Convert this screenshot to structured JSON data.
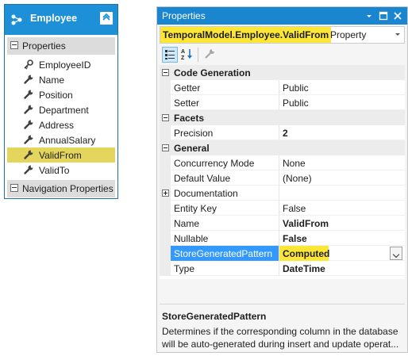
{
  "entity": {
    "title": "Employee",
    "properties_label": "Properties",
    "properties": [
      {
        "label": "EmployeeID",
        "icon": "key-icon",
        "selected": false
      },
      {
        "label": "Name",
        "icon": "wrench-icon",
        "selected": false
      },
      {
        "label": "Position",
        "icon": "wrench-icon",
        "selected": false
      },
      {
        "label": "Department",
        "icon": "wrench-icon",
        "selected": false
      },
      {
        "label": "Address",
        "icon": "wrench-icon",
        "selected": false
      },
      {
        "label": "AnnualSalary",
        "icon": "wrench-icon",
        "selected": false
      },
      {
        "label": "ValidFrom",
        "icon": "wrench-icon",
        "selected": true
      },
      {
        "label": "ValidTo",
        "icon": "wrench-icon",
        "selected": false
      }
    ],
    "navigation_label": "Navigation Properties"
  },
  "properties_window": {
    "title": "Properties",
    "object_name": "TemporalModel.Employee.ValidFrom",
    "object_type": "Property",
    "categories": [
      {
        "label": "Code Generation",
        "rows": [
          {
            "name": "Getter",
            "value": "Public",
            "bold": false
          },
          {
            "name": "Setter",
            "value": "Public",
            "bold": false
          }
        ]
      },
      {
        "label": "Facets",
        "rows": [
          {
            "name": "Precision",
            "value": "2",
            "bold": true
          }
        ]
      },
      {
        "label": "General",
        "rows": [
          {
            "name": "Concurrency Mode",
            "value": "None",
            "bold": false
          },
          {
            "name": "Default Value",
            "value": "(None)",
            "bold": false
          },
          {
            "name": "Documentation",
            "value": "",
            "bold": false,
            "expandable": true
          },
          {
            "name": "Entity Key",
            "value": "False",
            "bold": false
          },
          {
            "name": "Name",
            "value": "ValidFrom",
            "bold": true
          },
          {
            "name": "Nullable",
            "value": "False",
            "bold": true
          },
          {
            "name": "StoreGeneratedPattern",
            "value": "Computed",
            "bold": true,
            "selected": true
          },
          {
            "name": "Type",
            "value": "DateTime",
            "bold": true
          }
        ]
      }
    ],
    "description_title": "StoreGeneratedPattern",
    "description_line1": "Determines if the corresponding column in the database",
    "description_line2": "will be auto-generated during insert and update operat..."
  },
  "colors": {
    "accent": "#1e90d8",
    "title_bar": "#1a86d0",
    "highlight_yellow": "#fde635",
    "entity_selected": "#e4d65c",
    "selection_blue": "#3399ff"
  }
}
